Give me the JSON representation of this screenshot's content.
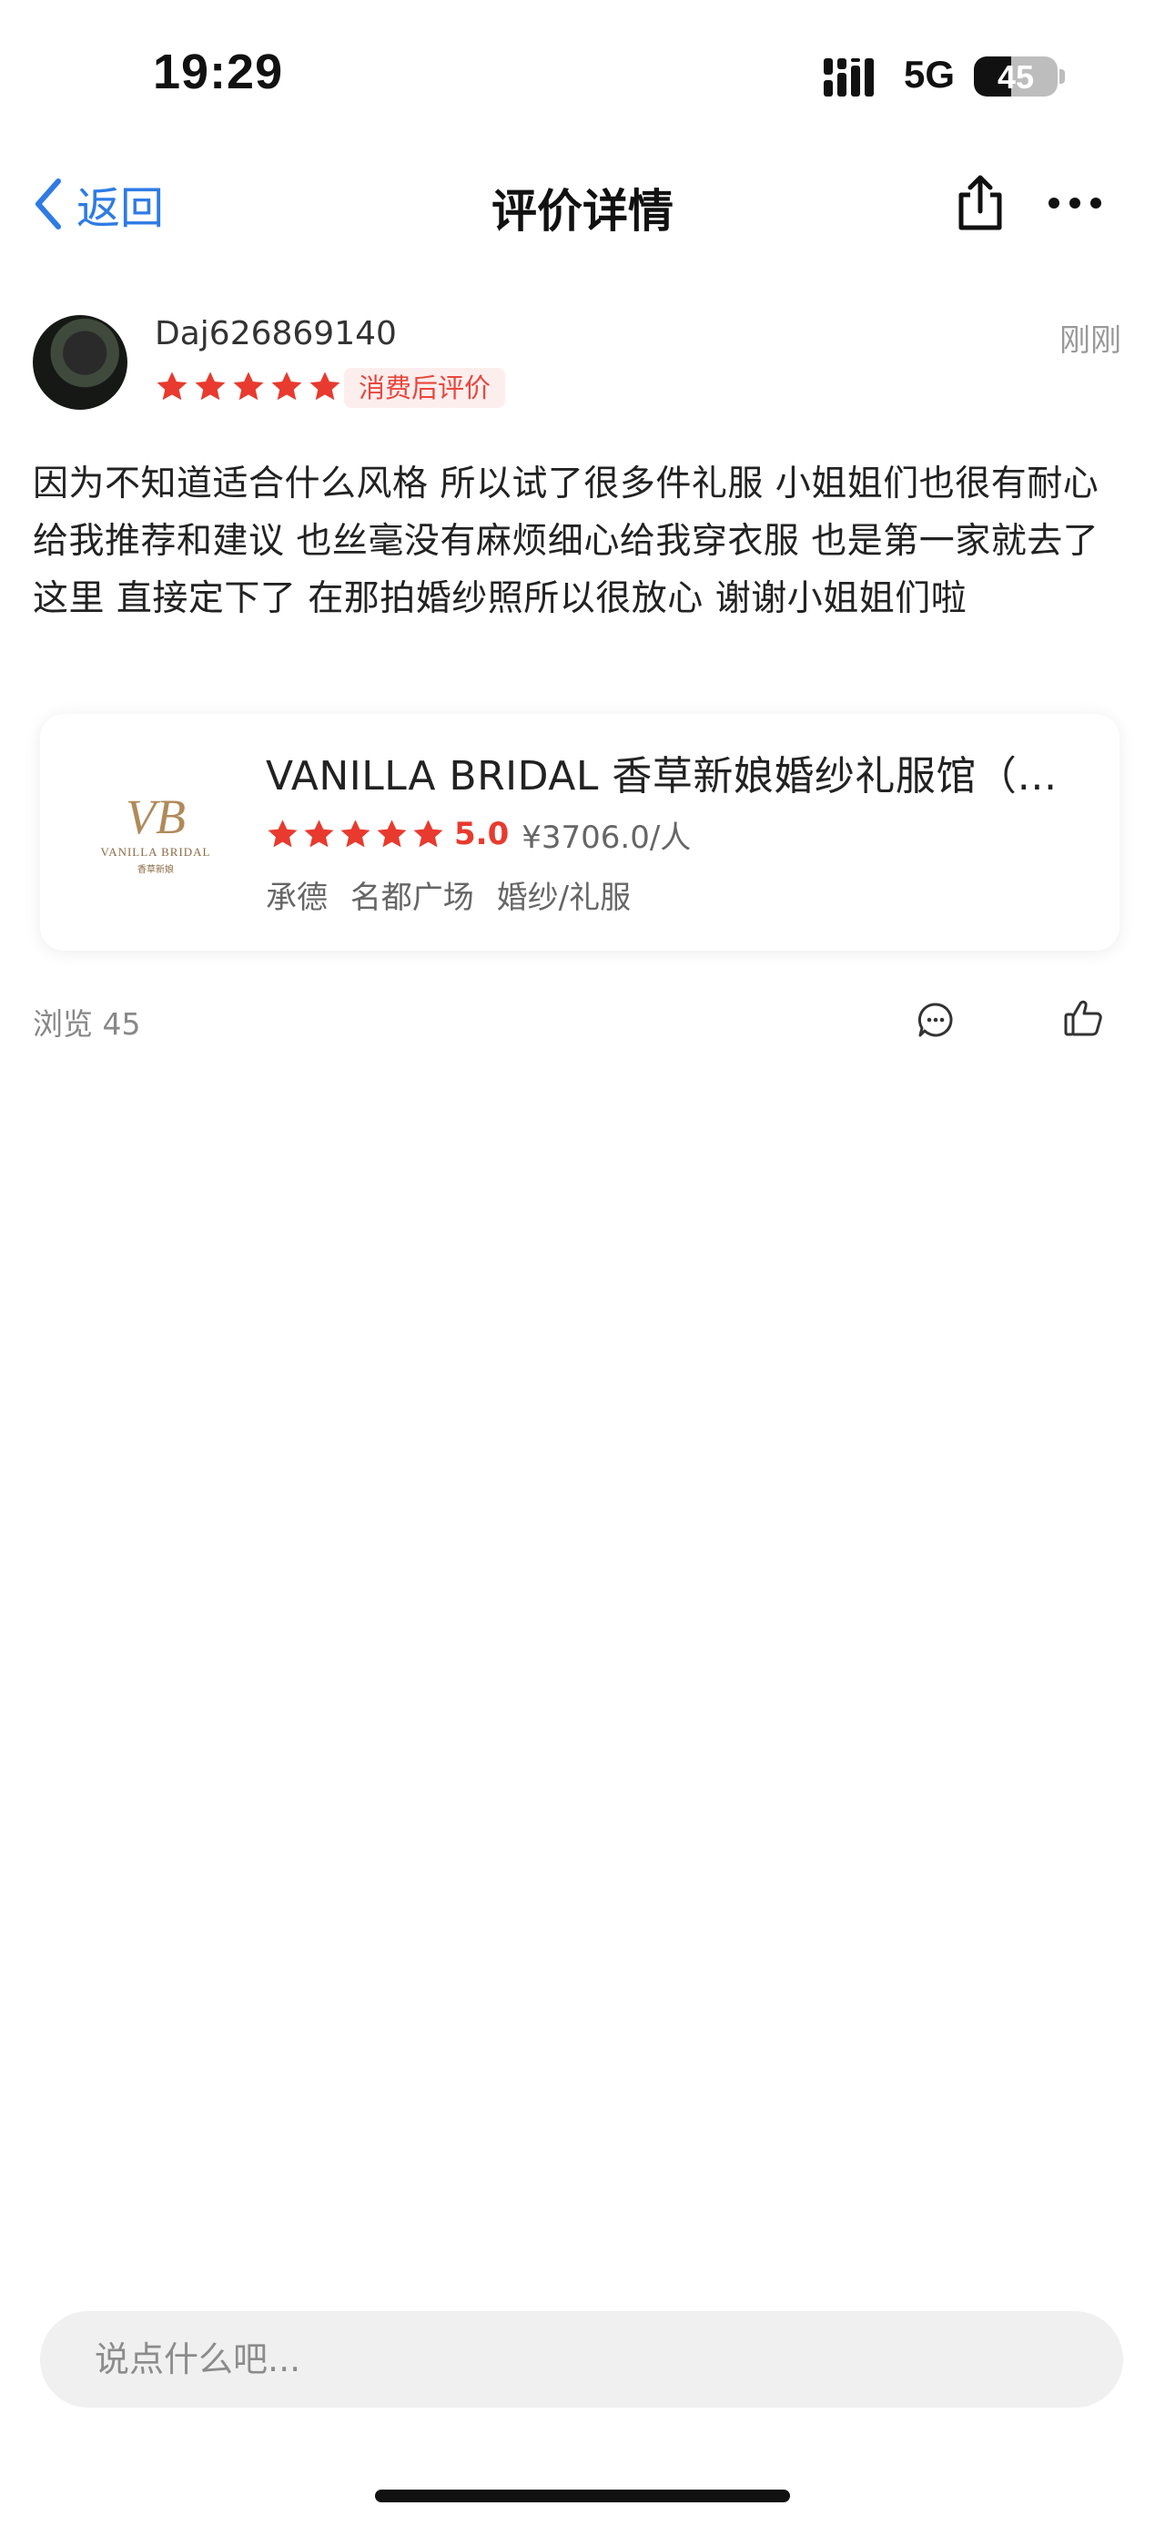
{
  "status_bar": {
    "time": "19:29",
    "network": "5G",
    "battery": "45",
    "battery_level": 0.45
  },
  "nav": {
    "back_label": "返回",
    "title": "评价详情",
    "share_icon": "share-icon",
    "more_icon": "more-icon"
  },
  "review": {
    "username": "Daj626869140",
    "time_ago": "刚刚",
    "rating": 5,
    "badge": "消费后评价",
    "content": "因为不知道适合什么风格  所以试了很多件礼服  小姐姐们也很有耐心给我推荐和建议   也丝毫没有麻烦细心给我穿衣服   也是第一家就去了这里  直接定下了  在那拍婚纱照所以很放心  谢谢小姐姐们啦"
  },
  "shop": {
    "name": "VANILLA  BRIDAL 香草新娘婚纱礼服馆（…",
    "logo_mark": "VB",
    "logo_text": "VANILLA BRIDAL",
    "logo_cn": "香草新娘",
    "rating": 5,
    "score": "5.0",
    "price": "¥3706.0/人",
    "city": "承德",
    "area": "名都广场",
    "category": "婚纱/礼服"
  },
  "stats": {
    "views": "浏览 45"
  },
  "comment": {
    "placeholder": "说点什么吧..."
  },
  "colors": {
    "accent": "#2f7be5",
    "star": "#e83a2e",
    "badge_bg": "#fdeeee"
  }
}
